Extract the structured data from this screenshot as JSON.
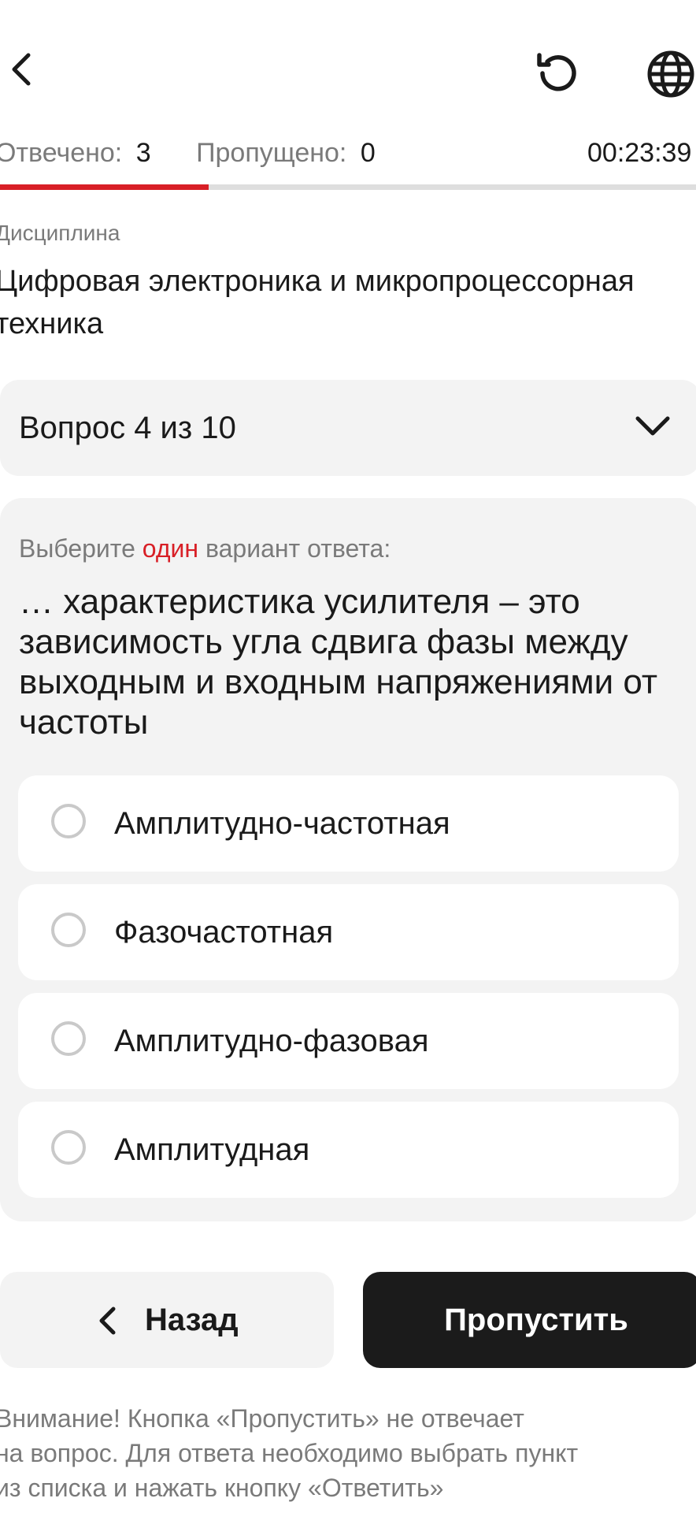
{
  "header": {
    "back_icon": "chevron-left-icon",
    "restart_icon": "restart-icon",
    "language_icon": "globe-icon"
  },
  "stats": {
    "answered_label": "Отвечено:",
    "answered_value": "3",
    "skipped_label": "Пропущено:",
    "skipped_value": "0",
    "timer": "00:23:39"
  },
  "progress": {
    "answered": 3,
    "total": 10,
    "fill_color": "#d81f26"
  },
  "discipline": {
    "caption": "Дисциплина",
    "title": "Цифровая электроника и микропроцессорная техника"
  },
  "question_selector": {
    "label": "Вопрос 4 из 10"
  },
  "question": {
    "instruction_before": "Выберите ",
    "instruction_accent": "один",
    "instruction_after": " вариант ответа:",
    "text": "… характеристика усилителя – это зависимость угла сдвига фазы между выходным и входным напряжениями от частоты",
    "options": [
      "Амплитудно-частотная",
      "Фазочастотная",
      "Амплитудно-фазовая",
      "Амплитудная"
    ]
  },
  "buttons": {
    "back_label": "Назад",
    "skip_label": "Пропустить"
  },
  "notice": {
    "line1": "Внимание! Кнопка «Пропустить» не отвечает",
    "line2": "на вопрос. Для ответа необходимо выбрать пункт",
    "line3": "из списка и нажать кнопку «Ответить»"
  },
  "colors": {
    "accent": "#d81f26",
    "card_bg": "#f3f3f3",
    "primary_button": "#1b1b1b"
  }
}
